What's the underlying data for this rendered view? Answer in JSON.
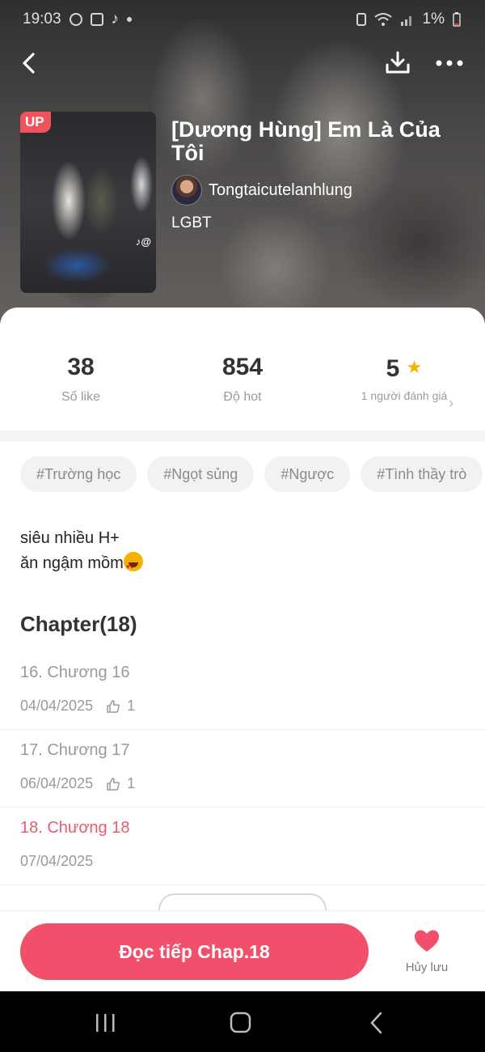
{
  "status": {
    "time": "19:03",
    "battery": "1%"
  },
  "book": {
    "badge": "UP",
    "title": "[Dương Hùng] Em Là Của Tôi",
    "author": "Tongtaicutelanhlung",
    "genre": "LGBT"
  },
  "stats": {
    "likes": {
      "value": "38",
      "label": "Số like"
    },
    "hot": {
      "value": "854",
      "label": "Độ hot"
    },
    "rating": {
      "value": "5",
      "label": "1 người đánh giá"
    }
  },
  "tags": [
    "#Trường học",
    "#Ngọt sủng",
    "#Ngược",
    "#Tình thầy trò"
  ],
  "description": {
    "line1": "siêu nhiều H+",
    "line2": "ăn ngậm mồm"
  },
  "chapters": {
    "title": "Chapter(18)",
    "items": [
      {
        "name": "16. Chương 16",
        "date": "04/04/2025",
        "likes": "1"
      },
      {
        "name": "17. Chương 17",
        "date": "06/04/2025",
        "likes": "1"
      },
      {
        "name": "18. Chương 18",
        "date": "07/04/2025"
      }
    ]
  },
  "actions": {
    "continue_label": "Đọc tiếp Chap.18",
    "unsave_label": "Hủy lưu"
  },
  "colors": {
    "accent": "#f2506a",
    "current_chapter": "#e95a73",
    "star": "#f6b400"
  },
  "icons": [
    "back-icon",
    "download-icon",
    "more-icon",
    "star-icon",
    "thumbs-up-icon",
    "heart-icon",
    "chevron-right-icon",
    "recent-apps-icon",
    "home-icon",
    "nav-back-icon"
  ]
}
